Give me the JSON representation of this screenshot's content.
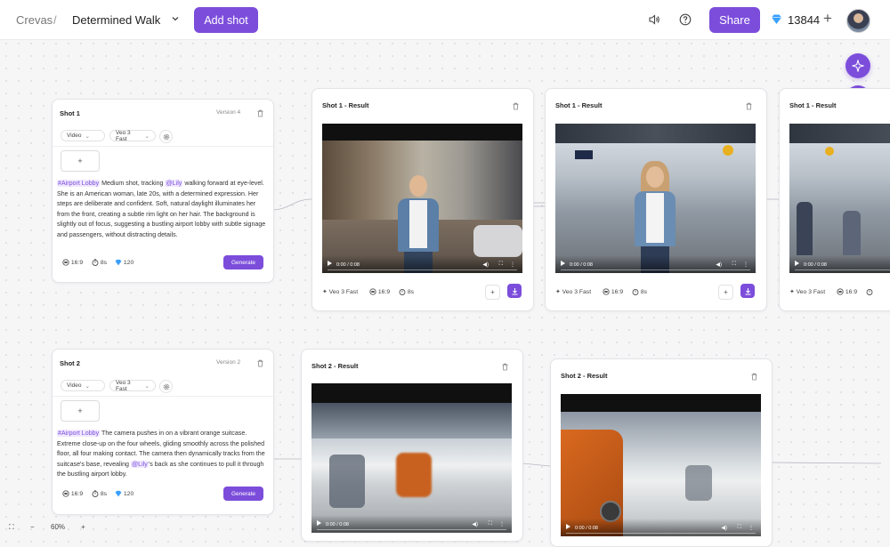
{
  "header": {
    "root": "Crevas",
    "separator": "/",
    "project_title": "Determined Walk",
    "add_shot_label": "Add shot",
    "share_label": "Share",
    "credits": "13844",
    "plus": "+"
  },
  "shots": [
    {
      "title": "Shot 1",
      "version": "Version 4",
      "type": "Video",
      "model": "Veo 3 Fast",
      "plus": "+",
      "tag": "#Airport Lobby",
      "prompt_a": " Medium shot, tracking ",
      "mention": "@Lily",
      "prompt_b": " walking forward at eye-level. She is an American woman, late 20s, with a determined expression. Her steps are deliberate and confident. Soft, natural daylight illuminates her from the front, creating a subtle rim light on her hair. The background is slightly out of focus, suggesting a bustling airport lobby with subtle signage and passengers, without distracting details.",
      "ratio": "16:9",
      "duration": "8s",
      "cost": "120",
      "generate_label": "Generate"
    },
    {
      "title": "Shot 2",
      "version": "Version 2",
      "type": "Video",
      "model": "Veo 3 Fast",
      "plus": "+",
      "tag": "#Airport Lobby",
      "prompt_a": " The camera pushes in on a vibrant orange suitcase. Extreme close-up on the four wheels, gliding smoothly across the polished floor, all four making contact. The camera then dynamically tracks from the suitcase's base, revealing ",
      "mention": "@Lily",
      "prompt_b": "'s back as she continues to pull it through the bustling airport lobby.",
      "ratio": "16:9",
      "duration": "8s",
      "cost": "120",
      "generate_label": "Generate"
    }
  ],
  "results": [
    {
      "title": "Shot 1 - Result",
      "time": "0:00 / 0:08",
      "model": "Veo 3 Fast",
      "ratio": "16:9",
      "duration": "8s"
    },
    {
      "title": "Shot 1 - Result",
      "time": "0:00 / 0:08",
      "model": "Veo 3 Fast",
      "ratio": "16:9",
      "duration": "8s"
    },
    {
      "title": "Shot 1 - Result",
      "time": "0:00 / 0:08",
      "model": "Veo 3 Fast",
      "ratio": "16:9",
      "duration": ""
    },
    {
      "title": "Shot 2 - Result",
      "time": "0:00 / 0:08"
    },
    {
      "title": "Shot 2 - Result",
      "time": "0:00 / 0:08"
    }
  ],
  "zoom": {
    "level": "60%",
    "minus": "−",
    "plus": "+"
  },
  "colors": {
    "accent": "#7c4ddb",
    "tag_bg": "#efe8ff"
  }
}
